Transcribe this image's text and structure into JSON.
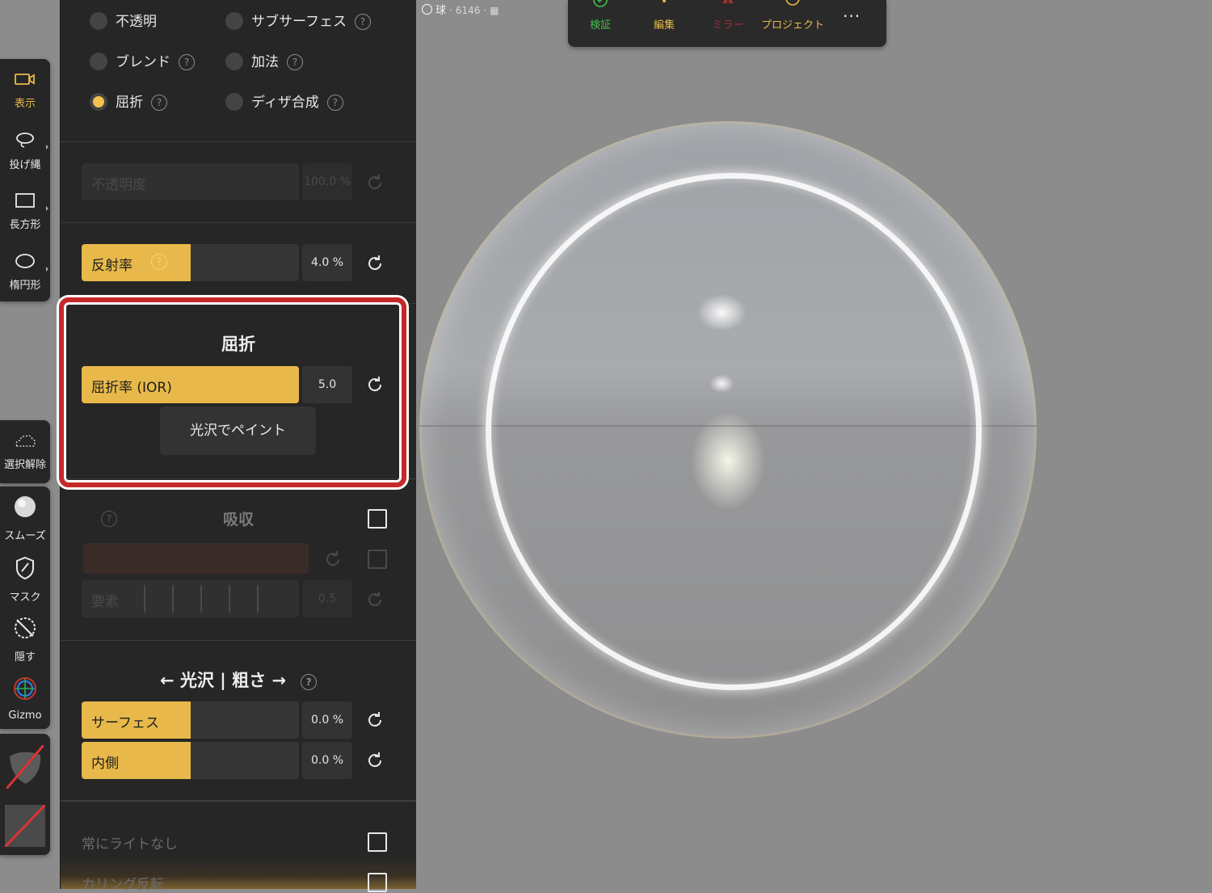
{
  "object_label": {
    "name": "球",
    "meta": "· 6146 ·"
  },
  "top_toolbar": {
    "items": [
      {
        "label": "検証",
        "icon": "check-shield-icon",
        "color": "#47c04a"
      },
      {
        "label": "編集",
        "icon": "edit-icon",
        "color": "#e8b94a"
      },
      {
        "label": "ミラー",
        "icon": "mirror-icon",
        "color": "#a42e36"
      },
      {
        "label": "プロジェクト",
        "icon": "project-icon",
        "color": "#e8b94a"
      }
    ],
    "more": "..."
  },
  "left_tools_top": [
    {
      "label": "表示",
      "icon": "camera-icon",
      "active": true
    },
    {
      "label": "投げ縄",
      "icon": "lasso-icon",
      "active": false
    },
    {
      "label": "長方形",
      "icon": "rectangle-icon",
      "active": false
    },
    {
      "label": "楕円形",
      "icon": "ellipse-icon",
      "active": false
    }
  ],
  "left_tools_bottom": [
    {
      "label": "選択解除",
      "icon": "cloud-deselect-icon"
    },
    {
      "label": "スムーズ",
      "icon": "smooth-brush-icon"
    },
    {
      "label": "マスク",
      "icon": "mask-icon"
    },
    {
      "label": "隠す",
      "icon": "hide-icon"
    },
    {
      "label": "Gizmo",
      "icon": "gizmo-icon"
    }
  ],
  "blend_modes": {
    "opaque": "不透明",
    "subsurface": "サブサーフェス",
    "blend": "ブレンド",
    "additive": "加法",
    "refraction": "屈折",
    "dither": "ディザ合成",
    "selected": "屈折",
    "help": "?"
  },
  "opacity": {
    "label": "不透明度",
    "value": "100.0 %"
  },
  "reflectance": {
    "label": "反射率",
    "value": "4.0 %",
    "fill_fraction": 0.4
  },
  "refraction": {
    "title": "屈折",
    "ior_label": "屈折率 (IOR)",
    "ior_value": "5.0",
    "paint_button": "光沢でペイント"
  },
  "absorption": {
    "title": "吸収",
    "factor_label": "要素",
    "factor_value": "0.5",
    "color": "#3a2c28"
  },
  "gloss_roughness": {
    "title": "← 光沢 | 粗さ →",
    "surface_label": "サーフェス",
    "surface_value": "0.0 %",
    "inner_label": "内側",
    "inner_value": "0.0 %"
  },
  "options": {
    "always_unlit": "常にライトなし",
    "flip_culling": "カリング反転"
  },
  "colors": {
    "accent": "#e8b94a",
    "highlight": "#c62828"
  }
}
